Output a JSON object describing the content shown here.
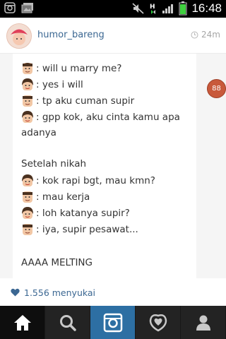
{
  "status_bar": {
    "time": "16:48",
    "icons": [
      "instagram-notification-icon",
      "image-notification-icon",
      "mute-icon",
      "hplus-data-icon",
      "signal-icon",
      "battery-icon"
    ]
  },
  "post": {
    "username": "humor_bareng",
    "timestamp": "24m",
    "badge_count": "88",
    "lines": [
      ": will u marry me?",
      ": yes i will",
      ": tp aku cuman supir",
      ": gpp kok, aku cinta kamu apa",
      "adanya",
      "Setelah nikah",
      ": kok rapi bgt, mau kmn?",
      ": mau kerja",
      ": loh katanya supir?",
      ": iya, supir pesawat...",
      "AAAA MELTING"
    ],
    "likes": "1.556 menyukai"
  },
  "nav": {
    "items": [
      "home",
      "explore",
      "camera",
      "activity",
      "profile"
    ]
  },
  "colors": {
    "accent": "#3b6792",
    "nav_bg": "#232323",
    "camera_bg": "#2d6fa3"
  }
}
